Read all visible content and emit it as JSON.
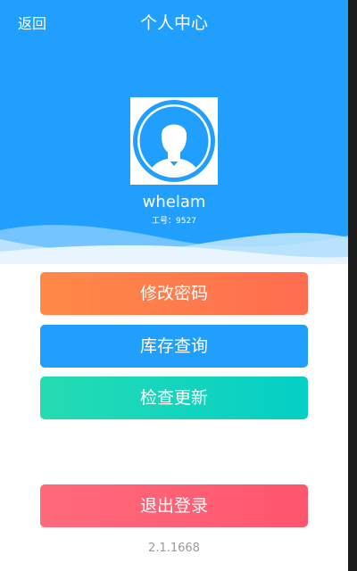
{
  "header": {
    "back_label": "返回",
    "title": "个人中心"
  },
  "profile": {
    "username": "whelam",
    "employee_id_label": "工号：",
    "employee_id": "9527"
  },
  "actions": {
    "change_password": "修改密码",
    "inventory_query": "库存查询",
    "check_update": "检查更新",
    "logout": "退出登录"
  },
  "version": "2.1.1668",
  "colors": {
    "header_bg": "#209ffe",
    "change_password": "#ff7c4c",
    "inventory_query": "#209ffe",
    "check_update": "#15d6bc",
    "logout": "#ff6074"
  },
  "icons": {
    "avatar": "default-user-avatar-icon"
  }
}
